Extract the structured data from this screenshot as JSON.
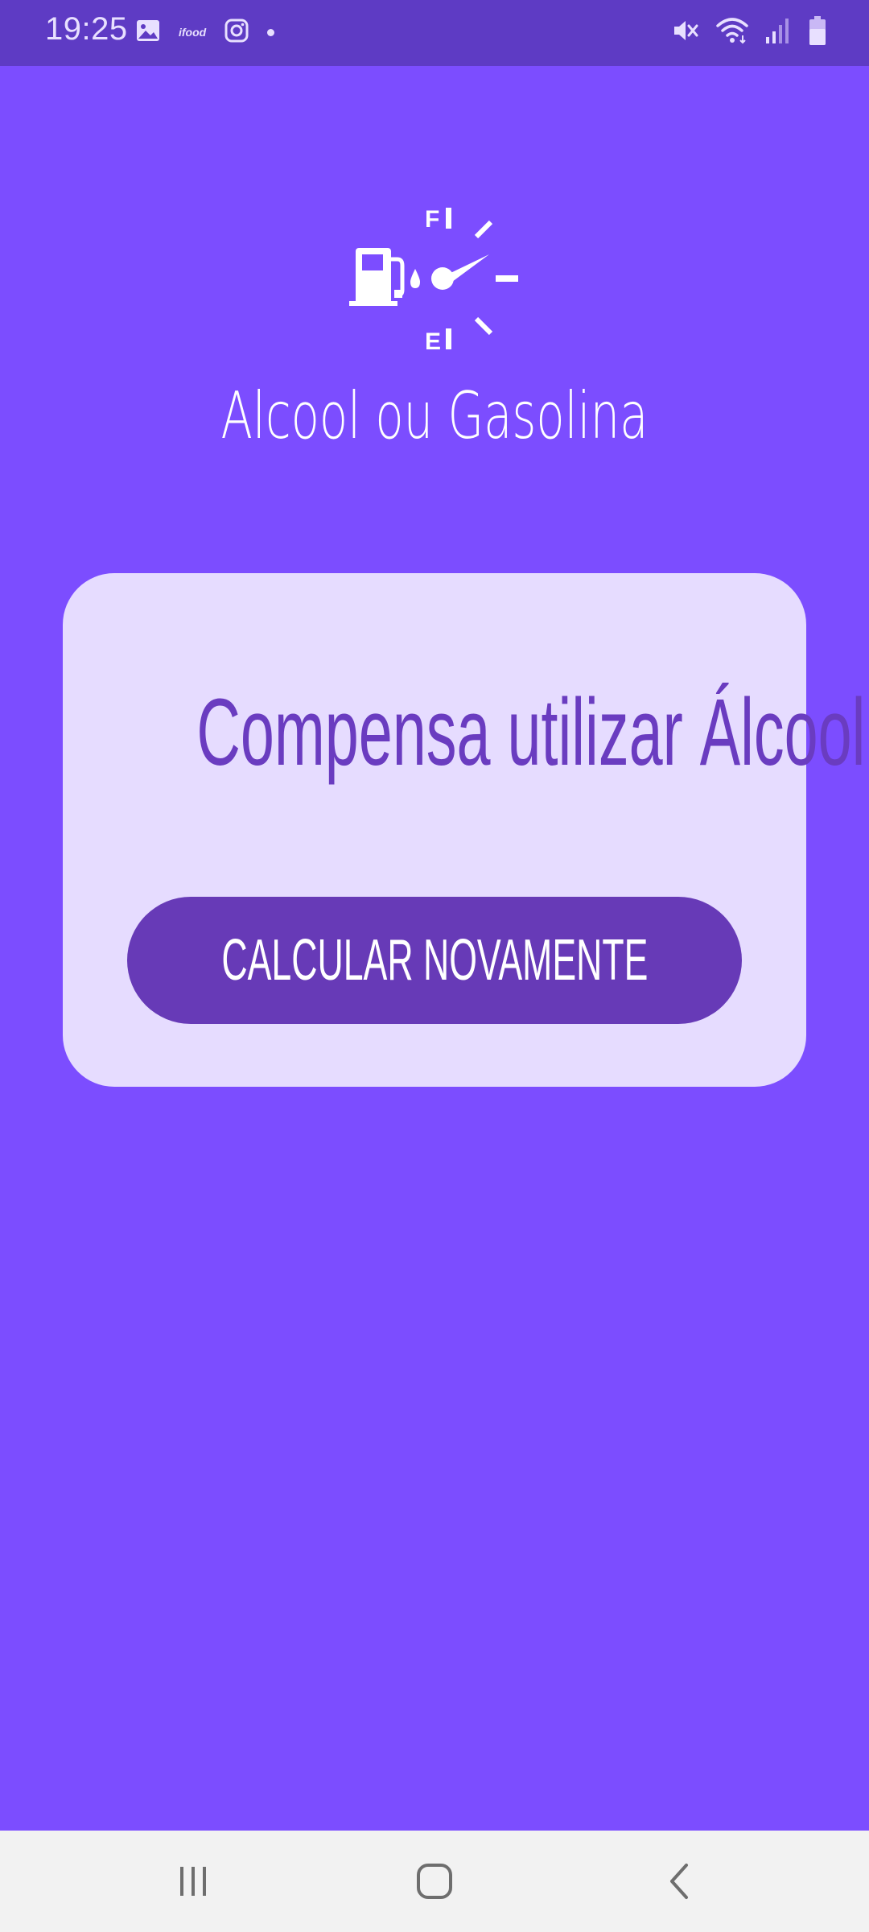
{
  "status_bar": {
    "time": "19:25",
    "notification_icons": [
      "gallery-icon",
      "ifood-icon",
      "instagram-icon",
      "more-notifications-dot"
    ],
    "ifood_label": "ifood",
    "system_icons": [
      "mute-icon",
      "wifi-icon",
      "signal-icon",
      "battery-icon"
    ]
  },
  "header": {
    "logo_icon": "fuel-gauge-icon",
    "gauge_full_label": "F",
    "gauge_empty_label": "E",
    "title": "Alcool ou Gasolina"
  },
  "result_card": {
    "message": "Compensa utilizar Álcool!",
    "button_label": "CALCULAR NOVAMENTE"
  },
  "nav_bar": {
    "buttons": [
      "recent-apps-icon",
      "home-icon",
      "back-icon"
    ]
  },
  "colors": {
    "background": "#7c4dff",
    "status_bar": "#5e3bc4",
    "card": "#e6dcff",
    "accent": "#673ab7",
    "result_text": "#6a3cc0",
    "nav_bar": "#f2f2f2"
  }
}
